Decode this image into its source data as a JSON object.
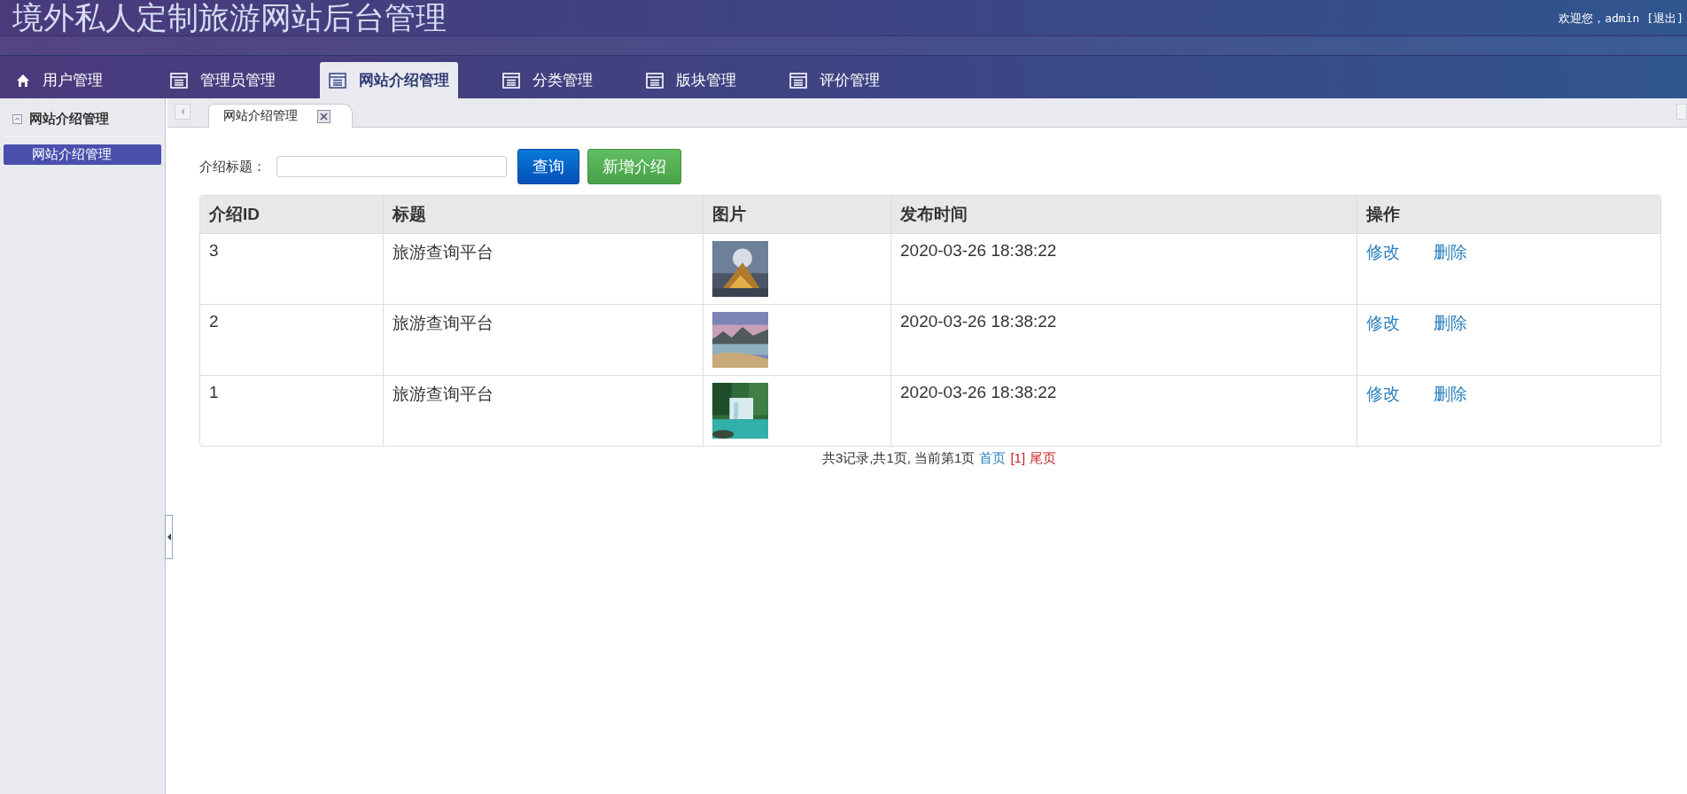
{
  "header": {
    "title": "境外私人定制旅游网站后台管理",
    "welcome": "欢迎您，admin",
    "logout": "[退出]"
  },
  "nav_tabs": [
    {
      "label": "用户管理",
      "kind": "home",
      "selected": false
    },
    {
      "label": "管理员管理",
      "kind": "page",
      "selected": false
    },
    {
      "label": "网站介绍管理",
      "kind": "page",
      "selected": true
    },
    {
      "label": "分类管理",
      "kind": "page",
      "selected": false
    },
    {
      "label": "版块管理",
      "kind": "page",
      "selected": false
    },
    {
      "label": "评价管理",
      "kind": "page",
      "selected": false
    }
  ],
  "sidebar": {
    "title": "网站介绍管理",
    "expanded": true,
    "items": [
      {
        "label": "网站介绍管理",
        "selected": true
      }
    ]
  },
  "page_tabs": [
    {
      "label": "网站介绍管理",
      "selected": true
    }
  ],
  "search": {
    "label": "介绍标题：",
    "query_button": "查询",
    "add_button": "新增介绍"
  },
  "table": {
    "columns": [
      "介绍ID",
      "标题",
      "图片",
      "发布时间",
      "操作"
    ],
    "rows": [
      {
        "id": "3",
        "title": "旅游查询平台",
        "image": {
          "kind": "picture"
        },
        "time": "2020-03-26 18:38:22",
        "actions": [
          "修改",
          "删除"
        ]
      },
      {
        "id": "2",
        "title": "旅游查询平台",
        "image": {
          "kind": "picture"
        },
        "time": "2020-03-26 18:38:22",
        "actions": [
          "修改",
          "删除"
        ]
      },
      {
        "id": "1",
        "title": "旅游查询平台",
        "image": {
          "kind": "picture"
        },
        "time": "2020-03-26 18:38:22",
        "actions": [
          "修改",
          "删除"
        ]
      }
    ]
  },
  "pagination": {
    "summary": "共3记录,共1页, 当前第1页",
    "first": "首页",
    "current": "[1]",
    "last": "尾页"
  }
}
